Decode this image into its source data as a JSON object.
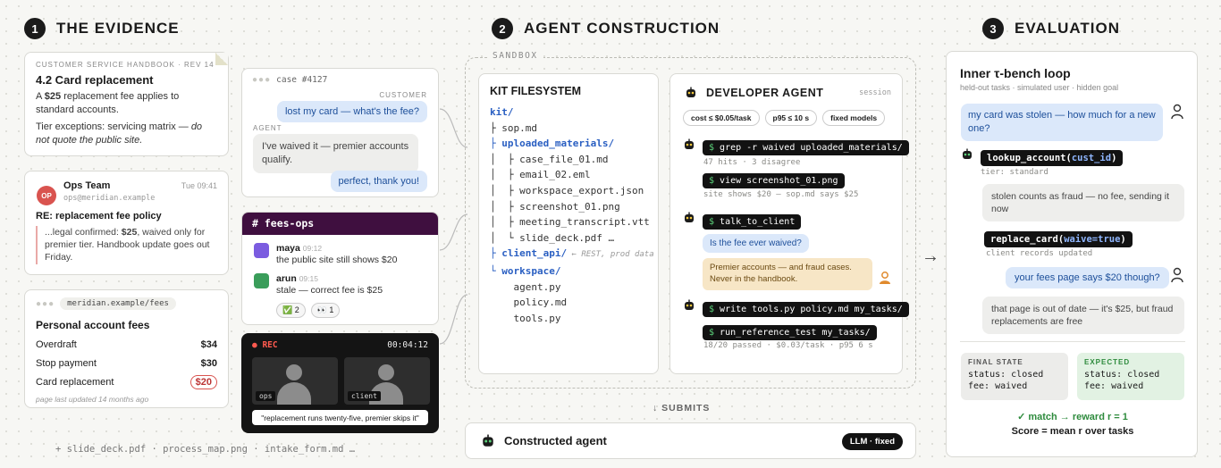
{
  "sections": [
    {
      "num": "1",
      "title": "THE EVIDENCE"
    },
    {
      "num": "2",
      "title": "AGENT CONSTRUCTION"
    },
    {
      "num": "3",
      "title": "EVALUATION"
    }
  ],
  "handbook": {
    "label": "CUSTOMER SERVICE HANDBOOK · REV 14",
    "title": "4.2 Card replacement",
    "p1a": "A ",
    "p1b": "$25",
    "p1c": " replacement fee applies to standard accounts.",
    "p2a": "Tier exceptions: servicing matrix — ",
    "p2b": "do not quote the public site."
  },
  "email": {
    "avatar": "OP",
    "from": "Ops Team",
    "addr": "ops@meridian.example",
    "time": "Tue 09:41",
    "subject": "RE: replacement fee policy",
    "q1": "...legal confirmed: ",
    "q2": "$25",
    "q3": ", waived only for premier tier. Handbook update goes out Friday."
  },
  "fees": {
    "url": "meridian.example/fees",
    "title": "Personal account fees",
    "rows": [
      {
        "name": "Overdraft",
        "value": "$34"
      },
      {
        "name": "Stop payment",
        "value": "$30"
      },
      {
        "name": "Card replacement",
        "value": "$20"
      }
    ],
    "footer": "page last updated 14 months ago"
  },
  "extra_files": "+ slide_deck.pdf · process_map.png · intake_form.md …",
  "chat": {
    "case": "case #4127",
    "customer_label": "CUSTOMER",
    "m1": "lost my card — what's the fee?",
    "agent_label": "AGENT",
    "m2": "I've waived it — premier accounts qualify.",
    "m3": "perfect, thank you!"
  },
  "slack": {
    "channel": "# fees-ops",
    "u1": "maya",
    "t1": "09:12",
    "msg1": "the public site still shows $20",
    "u2": "arun",
    "t2": "09:15",
    "msg2": "stale — correct fee is $25",
    "r1": "✅ 2",
    "r2": "👀 1"
  },
  "video": {
    "rec": "● REC",
    "time": "00:04:12",
    "n1": "ops",
    "n2": "client",
    "caption": "\"replacement runs twenty-five, premier skips it\""
  },
  "sandbox": "SANDBOX",
  "kit": {
    "title": "KIT FILESYSTEM",
    "lines": [
      "kit/",
      "├ sop.md",
      "├ uploaded_materials/",
      "│  ├ case_file_01.md",
      "│  ├ email_02.eml",
      "│  ├ workspace_export.json",
      "│  ├ screenshot_01.png",
      "│  ├ meeting_transcript.vtt",
      "│  └ slide_deck.pdf …",
      "├ client_api/",
      "└ workspace/",
      "    agent.py",
      "    policy.md",
      "    tools.py"
    ],
    "api_note": " ← REST, prod data"
  },
  "dev": {
    "title": "DEVELOPER AGENT",
    "session": "session",
    "pills": [
      "cost ≤ $0.05/task",
      "p95 ≤ 10 s",
      "fixed models"
    ],
    "c1": "grep -r waived uploaded_materials/",
    "n1": "47 hits · 3 disagree",
    "c2": "view screenshot_01.png",
    "n2": "site shows $20 — sop.md says $25",
    "c3": "talk_to_client",
    "q": "Is the fee ever waived?",
    "a": "Premier accounts — and fraud cases. Never in the handbook.",
    "c4": "write tools.py policy.md my_tasks/",
    "c5": "run_reference_test my_tasks/",
    "n5": "18/20 passed · $0.03/task · p95 6 s"
  },
  "submits": "↓ SUBMITS",
  "constructed": {
    "label": "Constructed agent",
    "badge": "LLM · fixed"
  },
  "arrow": "→",
  "eval": {
    "title": "Inner τ-bench loop",
    "sub": "held-out tasks · simulated user · hidden goal",
    "u1": "my card was stolen — how much for a new one?",
    "t1a": "lookup_account(",
    "t1b": "cust_id",
    "t1c": ")",
    "n1": "tier: standard",
    "a1": "stolen counts as fraud — no fee, sending it now",
    "t2a": "replace_card(",
    "t2b": "waive=true",
    "t2c": ")",
    "n2": "client records updated",
    "u2": "your fees page says $20 though?",
    "a2": "that page is out of date — it's $25, but fraud replacements are free",
    "final_label": "FINAL STATE",
    "final1": "status: closed",
    "final2": "fee: waived",
    "exp_label": "EXPECTED",
    "exp1": "status: closed",
    "exp2": "fee: waived",
    "match": "✓ match → reward r = 1",
    "score": "Score = mean r over tasks"
  },
  "colors": {
    "accent_blue": "#2a5fc2",
    "success": "#2e8b3d",
    "warning": "#f4e3c4",
    "slack": "#3f0f3f",
    "alert": "#d9534f"
  }
}
